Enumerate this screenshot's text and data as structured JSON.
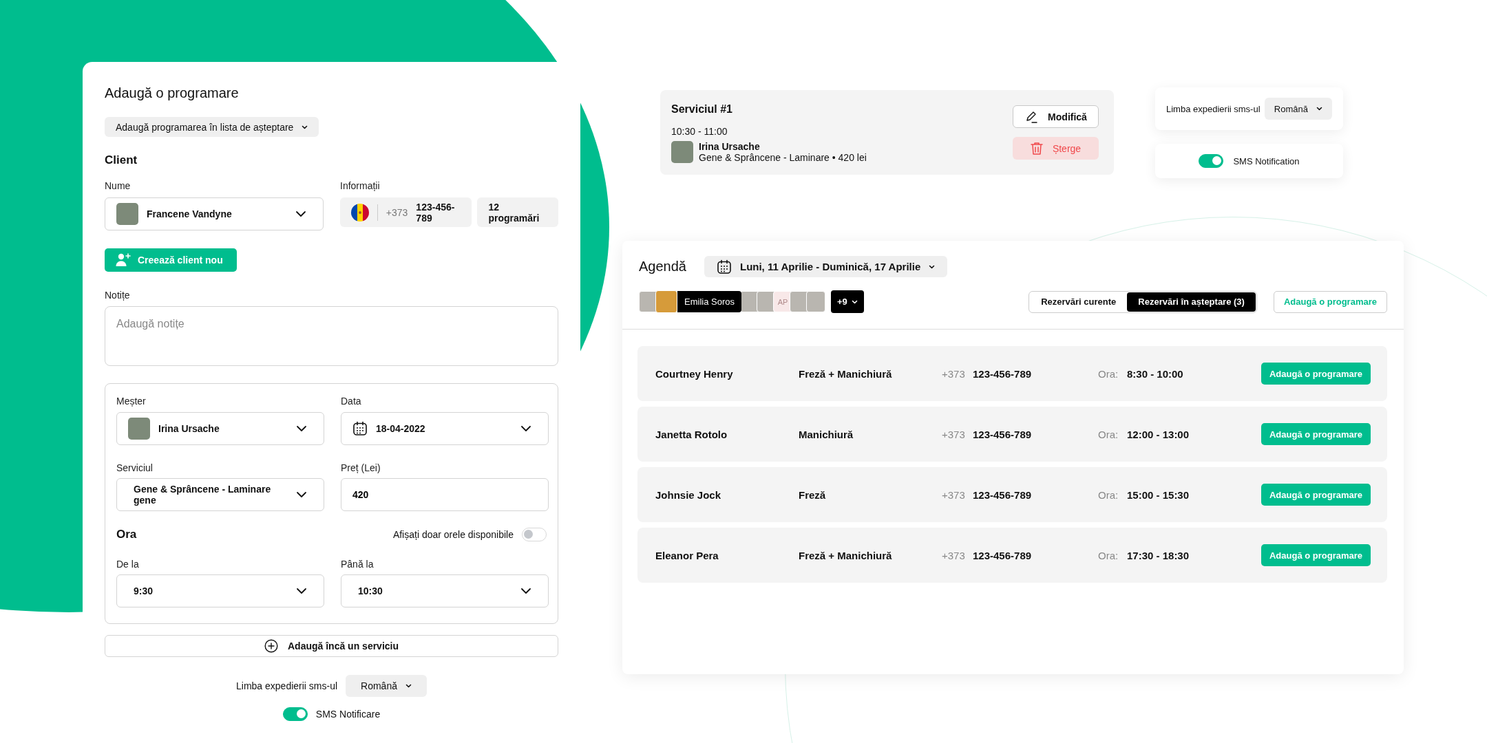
{
  "appointment_form": {
    "title": "Adaugă o programare",
    "waitlist_button": "Adaugă programarea în lista de așteptare",
    "client_heading": "Client",
    "name_label": "Nume",
    "client_name": "Francene Vandyne",
    "info_label": "Informații",
    "phone_prefix": "+373",
    "phone": "123-456-789",
    "appointments_count": "12 programări",
    "create_client_button": "Creează client nou",
    "notes_label": "Notițe",
    "notes_placeholder": "Adaugă notițe",
    "master_label": "Meșter",
    "master_name": "Irina Ursache",
    "date_label": "Data",
    "date": "18-04-2022",
    "service_label": "Serviciul",
    "service": "Gene & Sprâncene - Laminare gene",
    "price_label": "Preț (Lei)",
    "price": "420",
    "time_heading": "Ora",
    "available_only": {
      "label": "Afișați doar orele disponibile",
      "on": false
    },
    "from_label": "De la",
    "from": "9:30",
    "to_label": "Până la",
    "to": "10:30",
    "add_service_button": "Adaugă încă un serviciu",
    "sms_language_label": "Limba expedierii sms-ul",
    "sms_language": "Română",
    "sms_toggle": {
      "label": "SMS Notificare",
      "on": true
    }
  },
  "service_card": {
    "title": "Serviciul #1",
    "time": "10:30 - 11:00",
    "master_name": "Irina Ursache",
    "details": "Gene & Sprâncene - Laminare  •  420 lei",
    "edit_button": "Modifică",
    "delete_button": "Șterge"
  },
  "sms_language_card": {
    "label": "Limba expedierii sms-ul",
    "value": "Română"
  },
  "sms_card": {
    "label": "SMS Notification",
    "on": true
  },
  "agenda": {
    "title": "Agendă",
    "date_range": "Luni, 11 Aprilie - Duminică, 17 Aprilie",
    "masters": [
      {
        "kind": "photo",
        "selected": false
      },
      {
        "kind": "photo",
        "selected": true,
        "name": "Emilia Soros"
      },
      {
        "kind": "photo",
        "selected": false
      },
      {
        "kind": "photo",
        "selected": false
      },
      {
        "kind": "initials",
        "initials": "AP",
        "selected": false
      },
      {
        "kind": "photo",
        "selected": false
      },
      {
        "kind": "photo",
        "selected": false
      }
    ],
    "more_masters": "+9",
    "tabs": [
      {
        "label": "Rezervări curente",
        "selected": false
      },
      {
        "label": "Rezervări în așteptare (3)",
        "selected": true
      }
    ],
    "add_button": "Adaugă o programare",
    "rows": [
      {
        "name": "Courtney Henry",
        "service": "Freză + Manichiură",
        "phone_prefix": "+373",
        "phone": "123-456-789",
        "time_label": "Ora:",
        "time": "8:30 - 10:00",
        "button": "Adaugă o programare"
      },
      {
        "name": "Janetta Rotolo",
        "service": "Manichiură",
        "phone_prefix": "+373",
        "phone": "123-456-789",
        "time_label": "Ora:",
        "time": "12:00 - 13:00",
        "button": "Adaugă o programare"
      },
      {
        "name": "Johnsie Jock",
        "service": "Freză",
        "phone_prefix": "+373",
        "phone": "123-456-789",
        "time_label": "Ora:",
        "time": "15:00 - 15:30",
        "button": "Adaugă o programare"
      },
      {
        "name": "Eleanor Pera",
        "service": "Freză + Manichiură",
        "phone_prefix": "+373",
        "phone": "123-456-789",
        "time_label": "Ora:",
        "time": "17:30 - 18:30",
        "button": "Adaugă o programare"
      }
    ]
  }
}
